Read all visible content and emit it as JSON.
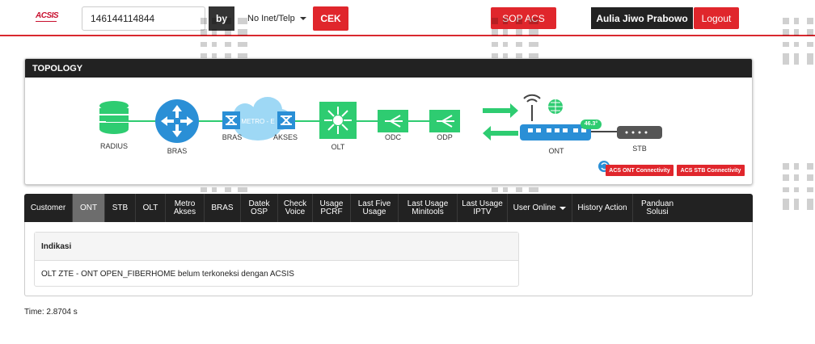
{
  "header": {
    "logo": "ACSIS",
    "search_value": "146144114844",
    "by_label": "by",
    "select_value": "No Inet/Telp",
    "cek_label": "CEK",
    "sop_label": "SOP ACS",
    "user_name": "Aulia Jiwo Prabowo",
    "logout_label": "Logout"
  },
  "topology": {
    "title": "TOPOLOGY",
    "nodes": {
      "radius": "RADIUS",
      "bras": "BRAS",
      "bras2": "BRAS",
      "metro": "METRO - E",
      "akses": "AKSES",
      "olt": "OLT",
      "odc": "ODC",
      "odp": "ODP",
      "ont": "ONT",
      "stb": "STB"
    },
    "ont_badge": "46.3°",
    "ont_connectivity": "ACS ONT Connectivity",
    "stb_connectivity": "ACS STB Connectivity",
    "colors": {
      "link": "#2ecc71",
      "node_blue": "#2a8fd6",
      "node_green": "#2ecc71",
      "accent": "#e0262c"
    }
  },
  "tabs": [
    {
      "label": "Customer"
    },
    {
      "label": "ONT",
      "active": true
    },
    {
      "label": "STB"
    },
    {
      "label": "OLT"
    },
    {
      "label": "Metro Akses"
    },
    {
      "label": "BRAS"
    },
    {
      "label": "Datek OSP"
    },
    {
      "label": "Check Voice"
    },
    {
      "label": "Usage PCRF"
    },
    {
      "label": "Last Five Usage"
    },
    {
      "label": "Last Usage Minitools"
    },
    {
      "label": "Last Usage IPTV"
    },
    {
      "label": "User Online",
      "dropdown": true
    },
    {
      "label": "History Action"
    },
    {
      "label": "Panduan Solusi"
    }
  ],
  "indikasi": {
    "header": "Indikasi",
    "message": "OLT ZTE - ONT OPEN_FIBERHOME belum terkoneksi dengan ACSIS"
  },
  "footer": {
    "time": "Time: 2.8704 s"
  }
}
